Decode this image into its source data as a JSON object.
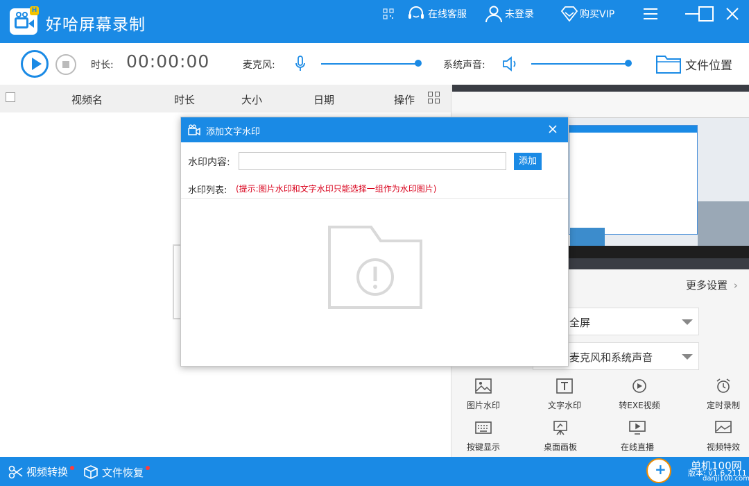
{
  "app": {
    "title": "好哈屏幕录制",
    "badge": "H"
  },
  "titlebar": {
    "service": "在线客服",
    "login": "未登录",
    "vip": "购买VIP"
  },
  "controls": {
    "duration_label": "时长:",
    "duration_value": "00:00:00",
    "mic_label": "麦克风:",
    "sys_label": "系统声音:",
    "file_location": "文件位置"
  },
  "list": {
    "columns": [
      "视频名",
      "时长",
      "大小",
      "日期",
      "操作"
    ]
  },
  "settings": {
    "more": "更多设置",
    "area_value": "全屏",
    "audio_value": "麦克风和系统声音"
  },
  "tools": [
    {
      "label": "图片水印",
      "icon": "image-icon"
    },
    {
      "label": "文字水印",
      "icon": "text-icon"
    },
    {
      "label": "转EXE视频",
      "icon": "convert-exe-icon"
    },
    {
      "label": "定时录制",
      "icon": "alarm-clock-icon"
    },
    {
      "label": "按键显示",
      "icon": "keyboard-icon"
    },
    {
      "label": "桌面画板",
      "icon": "easel-icon"
    },
    {
      "label": "在线直播",
      "icon": "monitor-play-icon"
    },
    {
      "label": "视频特效",
      "icon": "video-effect-icon"
    }
  ],
  "statusbar": {
    "convert": "视频转换",
    "recover": "文件恢复",
    "version": "版本: v1.6.2111"
  },
  "watermark": {
    "site": "单机100网",
    "domain": "danji100.com"
  },
  "modal": {
    "title": "添加文字水印",
    "content_label": "水印内容:",
    "content_value": "",
    "add_button": "添加",
    "list_label": "水印列表:",
    "hint": "(提示:图片水印和文字水印只能选择一组作为水印图片)"
  },
  "colors": {
    "accent": "#1a8ae5",
    "hint": "#d9001b"
  }
}
